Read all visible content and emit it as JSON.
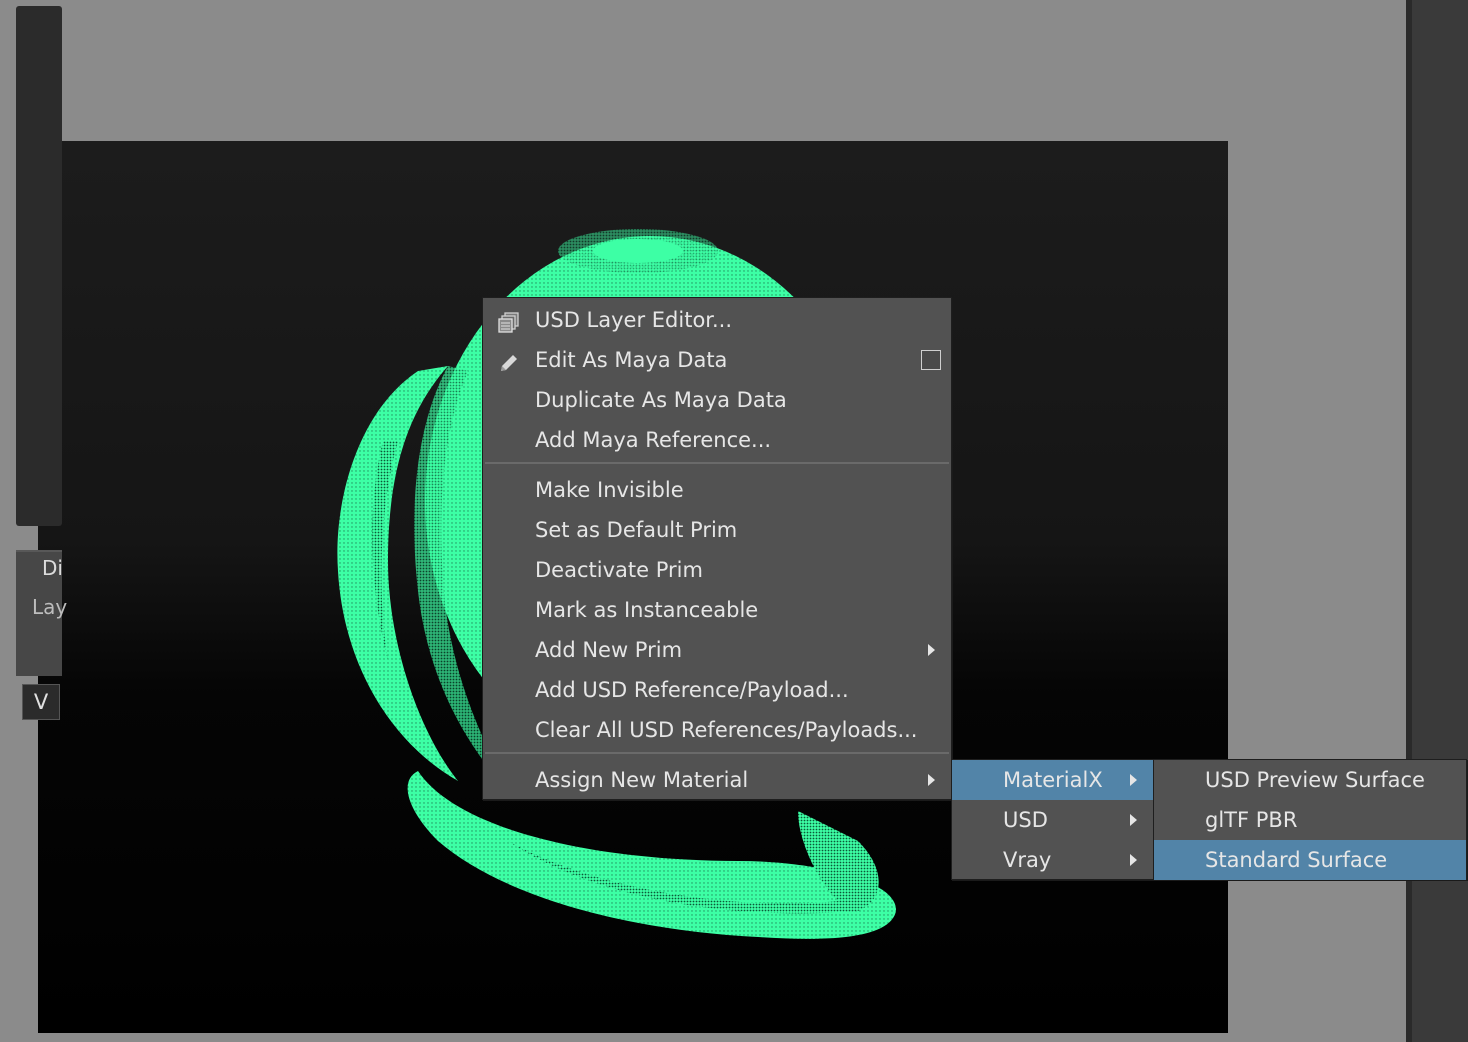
{
  "context_menu": {
    "items": [
      {
        "label": "USD Layer Editor...",
        "icon": "layers-icon"
      },
      {
        "label": "Edit As Maya Data",
        "icon": "pencil-icon",
        "has_checkbox": true
      },
      {
        "label": "Duplicate As Maya Data"
      },
      {
        "label": "Add Maya Reference..."
      },
      {
        "label": "Make Invisible"
      },
      {
        "label": "Set as Default Prim"
      },
      {
        "label": "Deactivate Prim"
      },
      {
        "label": "Mark as Instanceable"
      },
      {
        "label": "Add New Prim",
        "submenu": true
      },
      {
        "label": "Add USD Reference/Payload..."
      },
      {
        "label": "Clear All USD References/Payloads..."
      },
      {
        "label": "Assign New Material",
        "submenu": true
      }
    ]
  },
  "material_submenu": {
    "items": [
      {
        "label": "MaterialX",
        "submenu": true,
        "highlighted": true
      },
      {
        "label": "USD",
        "submenu": true
      },
      {
        "label": "Vray",
        "submenu": true
      }
    ]
  },
  "materialx_submenu": {
    "items": [
      {
        "label": "USD Preview Surface"
      },
      {
        "label": "glTF PBR"
      },
      {
        "label": "Standard Surface",
        "highlighted": true
      }
    ]
  },
  "right_panel": {
    "tab_label": "Di",
    "field_label": "Lay",
    "button_label": "V"
  },
  "colors": {
    "mesh_wireframe": "#3dffa5",
    "menu_background": "#525252",
    "menu_highlight": "#5284a8",
    "app_background": "#8b8b8b"
  }
}
